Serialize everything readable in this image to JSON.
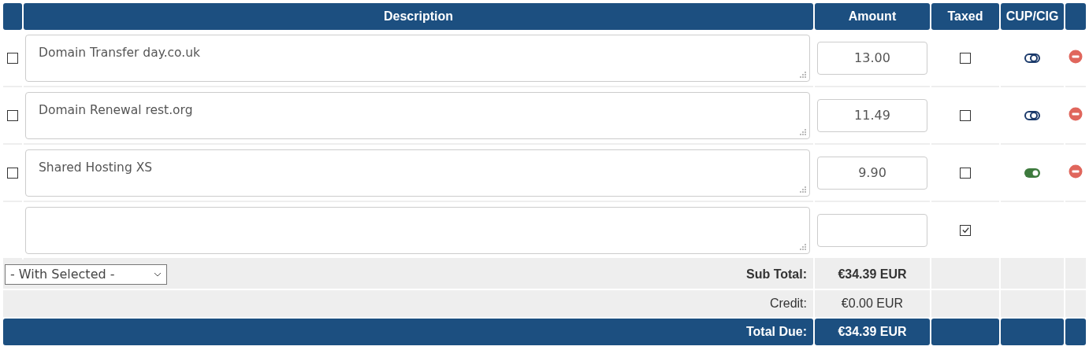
{
  "columns": [
    "Description",
    "Amount",
    "Taxed",
    "CUP/CIG"
  ],
  "rows": [
    {
      "kind": "item",
      "selected": false,
      "description": "Domain Transfer day.co.uk",
      "amount": "13.00",
      "taxed": false,
      "on": false
    },
    {
      "kind": "item",
      "selected": false,
      "description": "Domain Renewal rest.org",
      "amount": "11.49",
      "taxed": false,
      "on": false
    },
    {
      "kind": "item",
      "selected": false,
      "description": "Shared Hosting XS",
      "amount": "9.90",
      "taxed": false,
      "on": true
    },
    {
      "kind": "new",
      "taxed": true
    }
  ],
  "with_selected": "- With Selected -",
  "totals": [
    {
      "kind": "sub",
      "label": "Sub Total:",
      "value": "€34.39 EUR"
    },
    {
      "kind": "credit",
      "label": "Credit:",
      "value": "€0.00 EUR"
    },
    {
      "kind": "due",
      "label": "Total Due:",
      "value": "€34.39 EUR"
    }
  ]
}
